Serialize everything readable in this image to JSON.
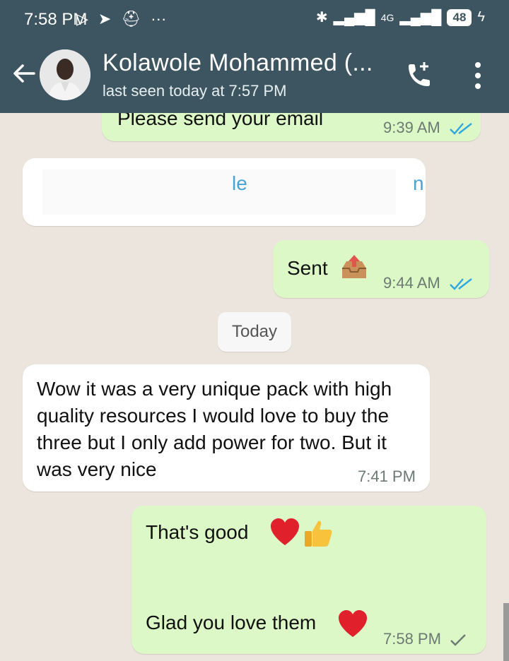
{
  "status_bar": {
    "time": "7:58 PM",
    "network": "4G",
    "battery": "48"
  },
  "header": {
    "contact_name": "Kolawole Mohammed (...",
    "last_seen": "last seen today at 7:57 PM"
  },
  "messages": [
    {
      "direction": "out",
      "text": "Please send your email",
      "time": "9:39 AM",
      "status": "read"
    },
    {
      "direction": "in",
      "text": "le",
      "tail": "n",
      "note": "partially hidden"
    },
    {
      "direction": "out",
      "text": "Sent",
      "time": "9:44 AM",
      "status": "read"
    },
    {
      "direction": "in",
      "text": "Wow it was a very unique pack with high quality resources I would love to buy the three but I only add power for two. But it was very nice",
      "time": "7:41 PM"
    },
    {
      "direction": "out",
      "text": "That's good",
      "text2": "Glad you love them",
      "time": "7:58 PM",
      "status": "sent"
    }
  ],
  "date_chip": "Today",
  "colors": {
    "header": "#3d5560",
    "chat_bg": "#ece5dd",
    "outgoing": "#dcf8c6",
    "incoming": "#ffffff",
    "read_ticks": "#2fa8e0"
  }
}
